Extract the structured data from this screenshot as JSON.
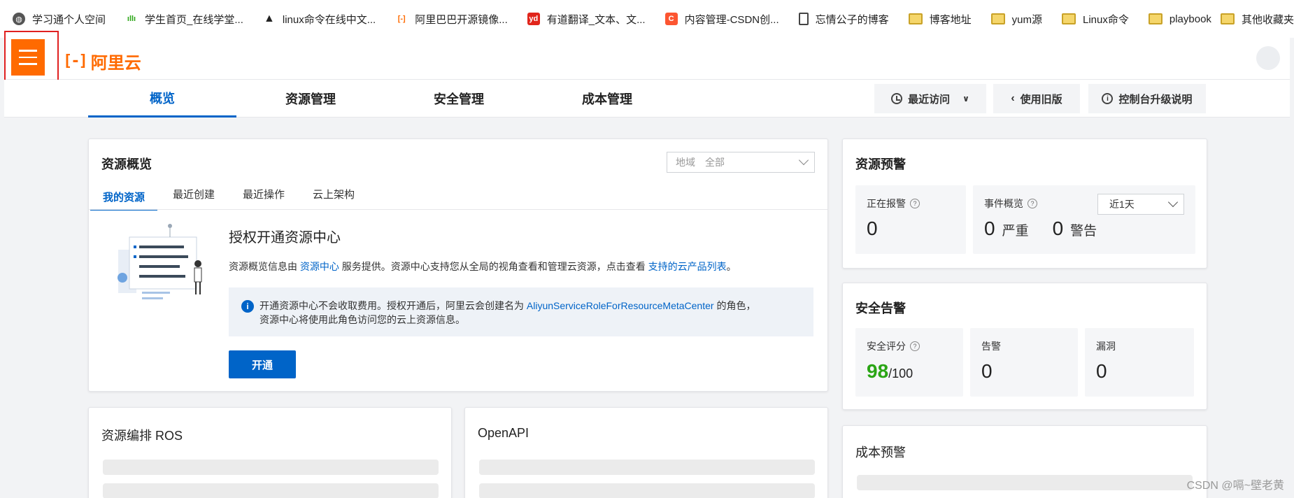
{
  "bookmarks": [
    {
      "label": "学习通个人空间",
      "icon": "globe-icon"
    },
    {
      "label": "学生首页_在线学堂...",
      "icon": "wave-icon"
    },
    {
      "label": "linux命令在线中文...",
      "icon": "penguin-icon"
    },
    {
      "label": "阿里巴巴开源镜像...",
      "icon": "aliyun-icon"
    },
    {
      "label": "有道翻译_文本、文...",
      "icon": "youdao-icon"
    },
    {
      "label": "内容管理-CSDN创...",
      "icon": "csdn-icon"
    },
    {
      "label": "忘情公子的博客",
      "icon": "page-icon"
    },
    {
      "label": "博客地址",
      "icon": "folder-icon"
    },
    {
      "label": "yum源",
      "icon": "folder-icon"
    },
    {
      "label": "Linux命令",
      "icon": "folder-icon"
    },
    {
      "label": "playbook",
      "icon": "folder-icon"
    }
  ],
  "bookmarks_other": "其他收藏夹",
  "brand": {
    "logo_mark": "[-]",
    "name": "阿里云",
    "accent": "#ff6a00"
  },
  "main_tabs": [
    {
      "label": "概览",
      "active": true
    },
    {
      "label": "资源管理"
    },
    {
      "label": "安全管理"
    },
    {
      "label": "成本管理"
    }
  ],
  "toolbar": {
    "recent": "最近访问",
    "old_version": "使用旧版",
    "upgrade_note": "控制台升级说明"
  },
  "resource_overview": {
    "title": "资源概览",
    "region_label": "地域",
    "region_value": "全部",
    "tabs": [
      "我的资源",
      "最近创建",
      "最近操作",
      "云上架构"
    ],
    "auth_title": "授权开通资源中心",
    "desc_prefix": "资源概览信息由",
    "desc_link1": "资源中心",
    "desc_mid": "服务提供。资源中心支持您从全局的视角查看和管理云资源，点击查看",
    "desc_link2": "支持的云产品列表",
    "desc_suffix": "。",
    "notice_prefix": "开通资源中心不会收取费用。授权开通后，阿里云会创建名为",
    "notice_role": "AliyunServiceRoleForResourceMetaCenter",
    "notice_suffix": "的角色，",
    "notice_line2": "资源中心将使用此角色访问您的云上资源信息。",
    "open_button": "开通"
  },
  "ros": {
    "title": "资源编排 ROS"
  },
  "openapi": {
    "title": "OpenAPI"
  },
  "resource_alert": {
    "title": "资源预警",
    "alarming_label": "正在报警",
    "alarming_value": "0",
    "events_label": "事件概览",
    "period": "近1天",
    "critical_value": "0",
    "critical_label": "严重",
    "warning_value": "0",
    "warning_label": "警告"
  },
  "security_alert": {
    "title": "安全告警",
    "score_label": "安全评分",
    "score_value": "98",
    "score_total": "/100",
    "alerts_label": "告警",
    "alerts_value": "0",
    "vuln_label": "漏洞",
    "vuln_value": "0"
  },
  "cost_alert": {
    "title": "成本预警"
  },
  "watermark": "CSDN @嗝~壁老黄"
}
